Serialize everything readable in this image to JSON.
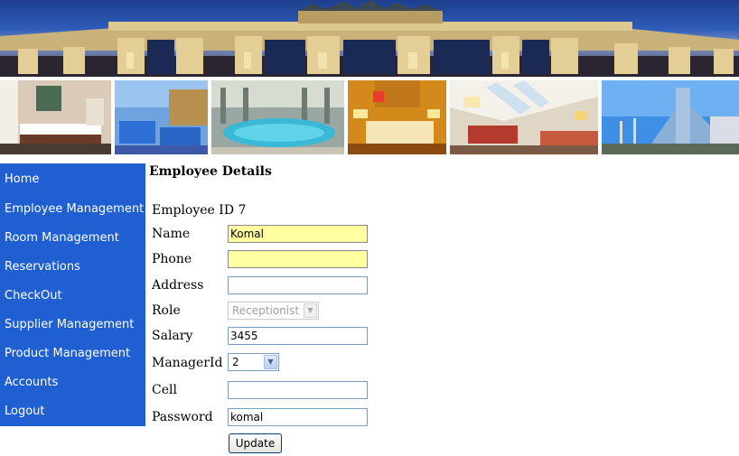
{
  "nav": {
    "items": [
      {
        "label": "Home"
      },
      {
        "label": "Employee Management"
      },
      {
        "label": "Room Management"
      },
      {
        "label": "Reservations"
      },
      {
        "label": "CheckOut"
      },
      {
        "label": "Supplier Management"
      },
      {
        "label": "Product Management"
      },
      {
        "label": "Accounts"
      },
      {
        "label": "Logout"
      }
    ]
  },
  "page": {
    "title": "Employee Details"
  },
  "form": {
    "employee_id_label": "Employee ID",
    "employee_id_value": "7",
    "name_label": "Name",
    "name_value": "Komal",
    "phone_label": "Phone",
    "phone_value": "",
    "address_label": "Address",
    "address_value": "",
    "role_label": "Role",
    "role_value": "Receptionist",
    "salary_label": "Salary",
    "salary_value": "3455",
    "managerid_label": "ManagerId",
    "managerid_value": "2",
    "cell_label": "Cell",
    "cell_value": "",
    "password_label": "Password",
    "password_value": "komal",
    "update_label": "Update"
  },
  "colors": {
    "sidebar": "#1f5fd2",
    "required_field": "#ffffa0",
    "input_border": "#7f9db9"
  }
}
